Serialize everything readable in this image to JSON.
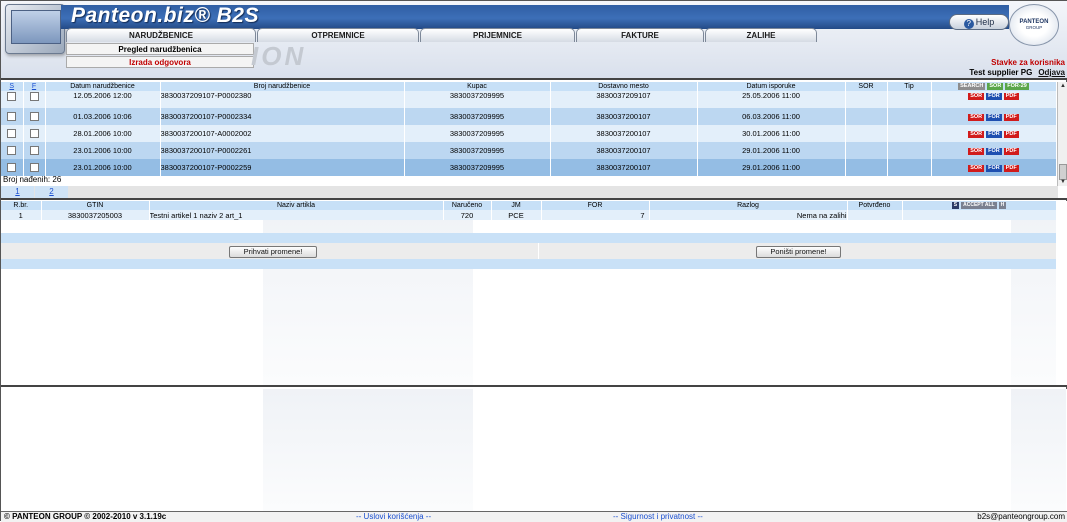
{
  "app": {
    "brand": "Panteon.biz® B2S",
    "watermark": "ION"
  },
  "header": {
    "help_label": "Help",
    "corner_logo": {
      "name": "PANTEON",
      "sub": "GROUP"
    },
    "tabs": [
      "NARUDŽBENICE",
      "OTPREMNICE",
      "PRIJEMNICE",
      "FAKTURE",
      "ZALIHE"
    ],
    "subnav": [
      "Pregled narudžbenica",
      "Izrada odgovora"
    ],
    "user": {
      "title": "Stavke za korisnika",
      "name": "Test supplier PG",
      "logout": "Odjava"
    }
  },
  "orders": {
    "columns": {
      "s": "S",
      "f": "F",
      "date": "Datum narudžbenice",
      "number": "Broj narudžbenice",
      "buyer": "Kupac",
      "delivery": "Dostavno mesto",
      "delivery_date": "Datum isporuke",
      "sor": "SOR",
      "type": "Tip"
    },
    "header_actions": [
      "SEARCH",
      "SOR",
      "FOR-29"
    ],
    "row_actions": [
      "SOR",
      "FOR",
      "PDF"
    ],
    "rows": [
      {
        "date": "12.05.2006 12:00",
        "number": "3830037209107-P0002380",
        "buyer": "3830037209995",
        "delivery": "3830037209107",
        "delivery_date": "25.05.2006 11:00"
      },
      {
        "date": "01.03.2006 10:06",
        "number": "3830037200107-P0002334",
        "buyer": "3830037209995",
        "delivery": "3830037200107",
        "delivery_date": "06.03.2006 11:00"
      },
      {
        "date": "28.01.2006 10:00",
        "number": "3830037200107-A0002002",
        "buyer": "3830037209995",
        "delivery": "3830037200107",
        "delivery_date": "30.01.2006 11:00"
      },
      {
        "date": "23.01.2006 10:00",
        "number": "3830037200107-P0002261",
        "buyer": "3830037209995",
        "delivery": "3830037200107",
        "delivery_date": "29.01.2006 11:00"
      },
      {
        "date": "23.01.2006 10:00",
        "number": "3830037200107-P0002259",
        "buyer": "3830037209995",
        "delivery": "3830037200107",
        "delivery_date": "29.01.2006 11:00"
      }
    ],
    "count_text": "Broj nađenih: 26",
    "pages": [
      "1",
      "2"
    ]
  },
  "items": {
    "columns": {
      "rbr": "R.br.",
      "gtin": "GTIN",
      "name": "Naziv artikla",
      "ordered": "Naručeno",
      "jm": "JM",
      "for": "FOR",
      "reason": "Razlog",
      "confirmed": "Potvrđeno"
    },
    "header_actions": [
      "S",
      "ACCEPT ALL",
      "H"
    ],
    "rows": [
      {
        "rbr": "1",
        "gtin": "3830037205003",
        "name": "Testni artikel 1 naziv 2 art_1",
        "ordered": "720",
        "jm": "PCE",
        "for": "7",
        "reason": "Nema na zalihi",
        "confirmed": ""
      }
    ],
    "accept_label": "Prihvati promene!",
    "cancel_label": "Poništi promene!"
  },
  "footer": {
    "copyright": "© PANTEON GROUP © 2002-2010 v 3.1.19c",
    "terms": "-- Uslovi korišćenja --",
    "privacy": "-- Sigurnost i privatnost --",
    "email": "b2s@panteongroup.com"
  }
}
